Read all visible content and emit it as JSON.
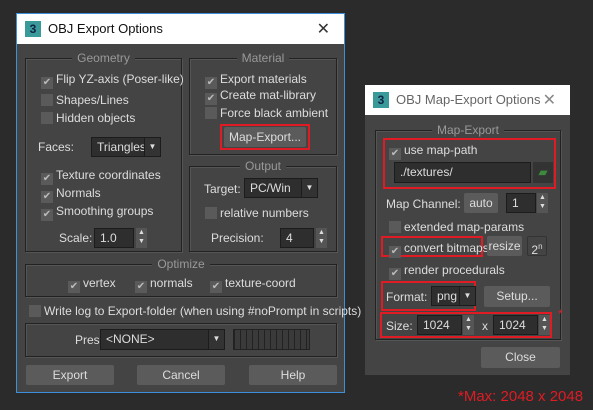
{
  "main": {
    "title": "OBJ Export Options",
    "geometry": {
      "label": "Geometry",
      "flip": "Flip YZ-axis (Poser-like)",
      "shapes": "Shapes/Lines",
      "hidden": "Hidden objects",
      "faces_label": "Faces:",
      "faces_value": "Triangles",
      "texcoords": "Texture coordinates",
      "normals": "Normals",
      "smoothing": "Smoothing groups",
      "scale_label": "Scale:",
      "scale_value": "1.0"
    },
    "material": {
      "label": "Material",
      "export": "Export materials",
      "matlib": "Create mat-library",
      "black": "Force black ambient",
      "map_export": "Map-Export..."
    },
    "output": {
      "label": "Output",
      "target_label": "Target:",
      "target_value": "PC/Win",
      "relative": "relative numbers",
      "precision_label": "Precision:",
      "precision_value": "4"
    },
    "optimize": {
      "label": "Optimize",
      "vertex": "vertex",
      "normals": "normals",
      "texcoord": "texture-coord"
    },
    "writelog": "Write log to Export-folder (when using #noPrompt in scripts)",
    "preset_label": "Preset:",
    "preset_value": "<NONE>",
    "buttons": {
      "export": "Export",
      "cancel": "Cancel",
      "help": "Help"
    }
  },
  "map": {
    "title": "OBJ Map-Export Options",
    "group": "Map-Export",
    "use_path": "use map-path",
    "path": "./textures/",
    "channel_label": "Map Channel:",
    "auto": "auto",
    "channel": "1",
    "extended": "extended map-params",
    "convert": "convert bitmaps",
    "resize": "resize",
    "pow2": "2",
    "pow2_sup": "n",
    "procedurals": "render procedurals",
    "format_label": "Format:",
    "format_value": "png",
    "setup": "Setup...",
    "size_label": "Size:",
    "width": "1024",
    "x": "x",
    "height": "1024",
    "close": "Close"
  },
  "note": {
    "asterisk": "*",
    "text": "*Max: 2048 x 2048"
  }
}
